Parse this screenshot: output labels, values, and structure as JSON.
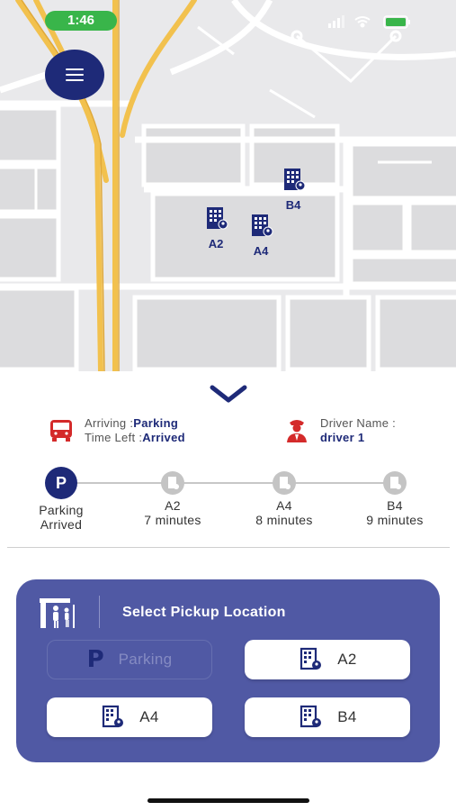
{
  "status_bar": {
    "time": "1:46",
    "time_color": "#39b54a"
  },
  "menu_button": {
    "icon": "hamburger-icon",
    "color": "#1e2a78"
  },
  "map": {
    "markers": [
      {
        "label": "B4",
        "icon": "building-location-icon"
      },
      {
        "label": "A2",
        "icon": "building-location-icon"
      },
      {
        "label": "A4",
        "icon": "building-location-icon"
      }
    ]
  },
  "collapse_icon": "chevron-down-icon",
  "trip": {
    "arriving_label": "Arriving :",
    "arriving_value": "Parking",
    "time_left_label": "Time Left :",
    "time_left_value": "Arrived",
    "driver_label": "Driver Name :",
    "driver_value": "driver 1",
    "bus_icon": "bus-icon",
    "driver_icon": "driver-icon",
    "accent_red": "#d42a2a"
  },
  "progress": {
    "stops": [
      {
        "name": "Parking",
        "status": "Arrived",
        "active": true,
        "glyph": "P"
      },
      {
        "name": "A2",
        "status": "7 minutes",
        "active": false
      },
      {
        "name": "A4",
        "status": "8 minutes",
        "active": false
      },
      {
        "name": "B4",
        "status": "9 minutes",
        "active": false
      }
    ]
  },
  "pickup": {
    "title": "Select Pickup Location",
    "header_icon": "bus-stop-icon",
    "panel_color": "#5059a4",
    "options": [
      {
        "label": "Parking",
        "icon": "parking-icon",
        "glyph": "P",
        "disabled": true
      },
      {
        "label": "A2",
        "icon": "building-location-icon",
        "disabled": false
      },
      {
        "label": "A4",
        "icon": "building-location-icon",
        "disabled": false
      },
      {
        "label": "B4",
        "icon": "building-location-icon",
        "disabled": false
      }
    ]
  },
  "colors": {
    "primary": "#1e2a78",
    "map_bg": "#e9e9eb",
    "road": "#f2c14e"
  }
}
